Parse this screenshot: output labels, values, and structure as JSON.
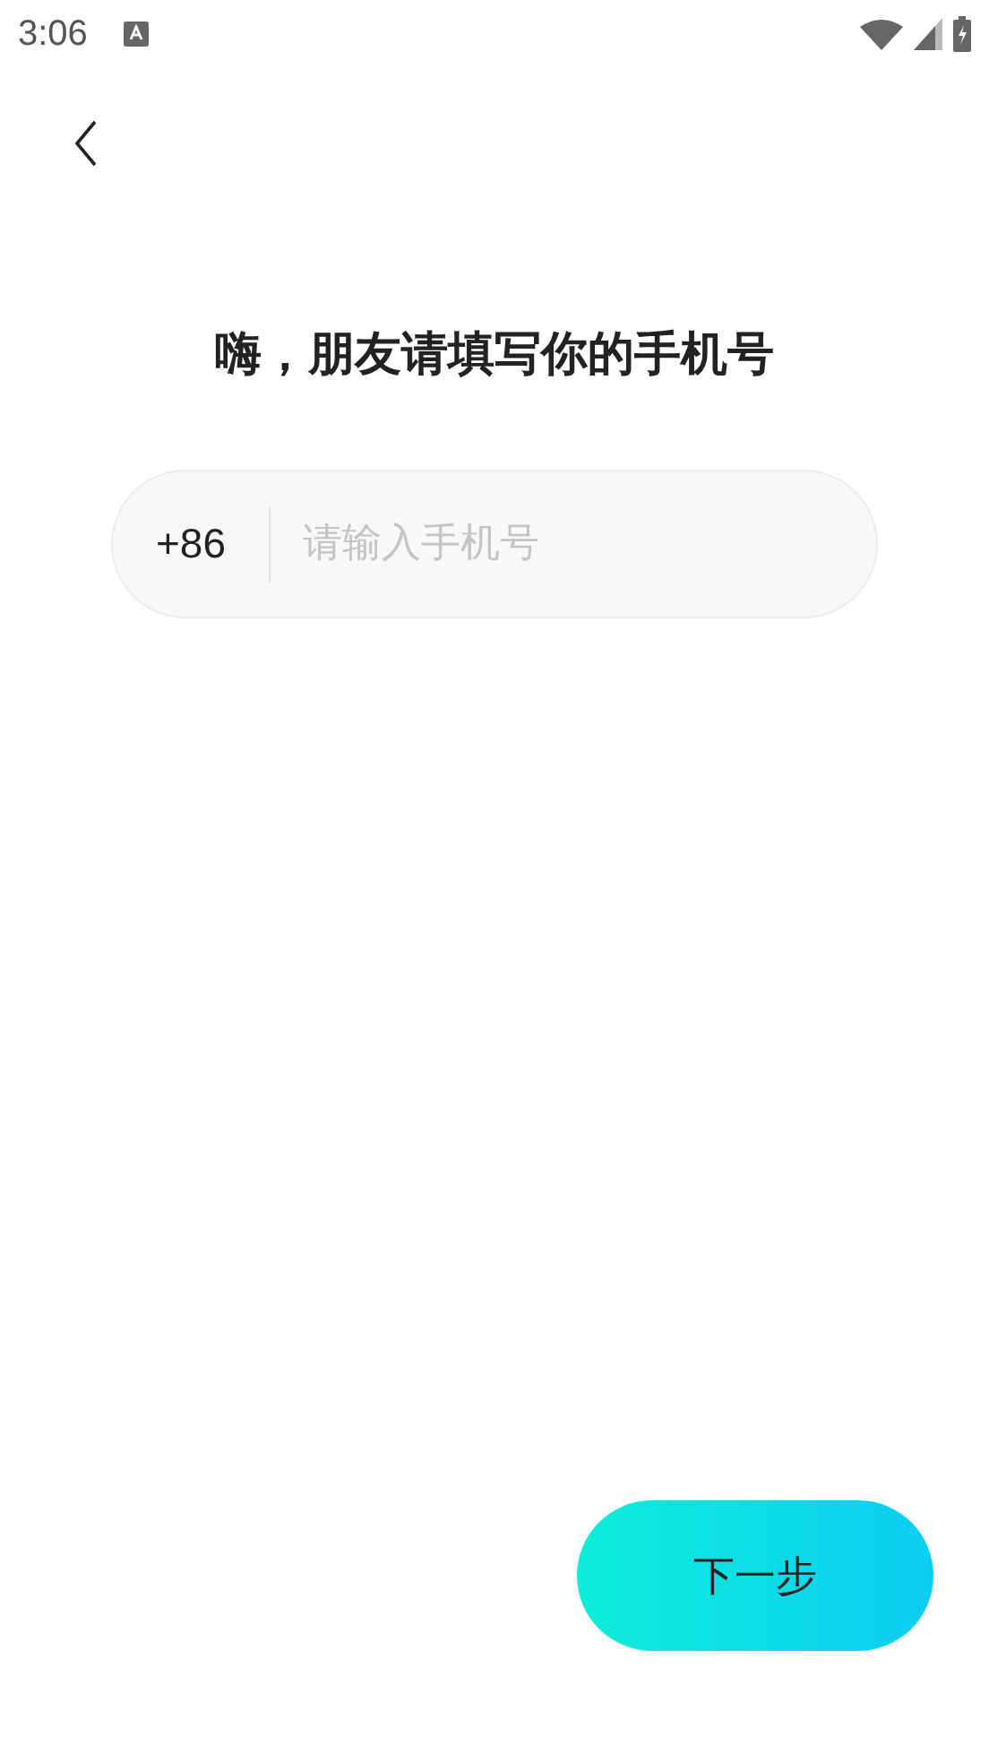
{
  "status_bar": {
    "time": "3:06"
  },
  "title": "嗨，朋友请填写你的手机号",
  "phone_field": {
    "country_code": "+86",
    "placeholder": "请输入手机号"
  },
  "next_button": {
    "label": "下一步"
  }
}
